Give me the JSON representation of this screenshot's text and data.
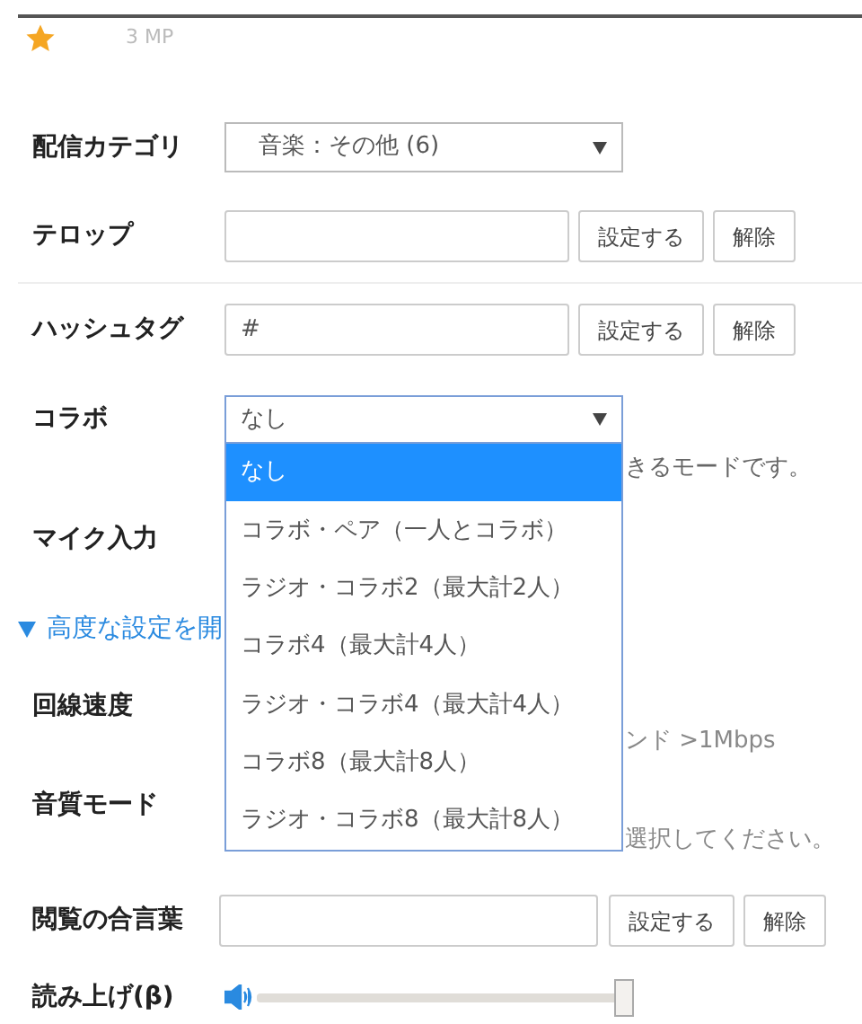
{
  "header": {
    "resolution": "3 MP"
  },
  "category": {
    "label": "配信カテゴリ",
    "value": "音楽：その他 (6)"
  },
  "telop": {
    "label": "テロップ",
    "buttons": [
      "設定する",
      "解除"
    ]
  },
  "hashtag": {
    "label": "ハッシュタグ",
    "value": "#",
    "buttons": [
      "設定する",
      "解除"
    ]
  },
  "collab": {
    "label": "コラボ",
    "value": "なし",
    "expanded": true,
    "options": [
      {
        "label": "なし",
        "selected": true
      },
      {
        "label": "コラボ・ペア（一人とコラボ）",
        "selected": false
      },
      {
        "label": "ラジオ・コラボ2（最大計2人）",
        "selected": false
      },
      {
        "label": "コラボ4（最大計4人）",
        "selected": false
      },
      {
        "label": "ラジオ・コラボ4（最大計4人）",
        "selected": false
      },
      {
        "label": "コラボ8（最大計8人）",
        "selected": false
      },
      {
        "label": "ラジオ・コラボ8（最大計8人）",
        "selected": false
      }
    ],
    "note": "きるモードです。"
  },
  "mic": {
    "label": "マイク入力"
  },
  "advanced_toggle": "高度な設定を開",
  "line_speed": {
    "label": "回線速度",
    "note": "ンド >1Mbps"
  },
  "quality": {
    "label": "音質モード",
    "note": "選択してください。"
  },
  "password": {
    "label": "閲覧の合言葉",
    "buttons": [
      "設定する",
      "解除"
    ]
  },
  "reading": {
    "label": "読み上げ(β)",
    "level": 0.97
  }
}
